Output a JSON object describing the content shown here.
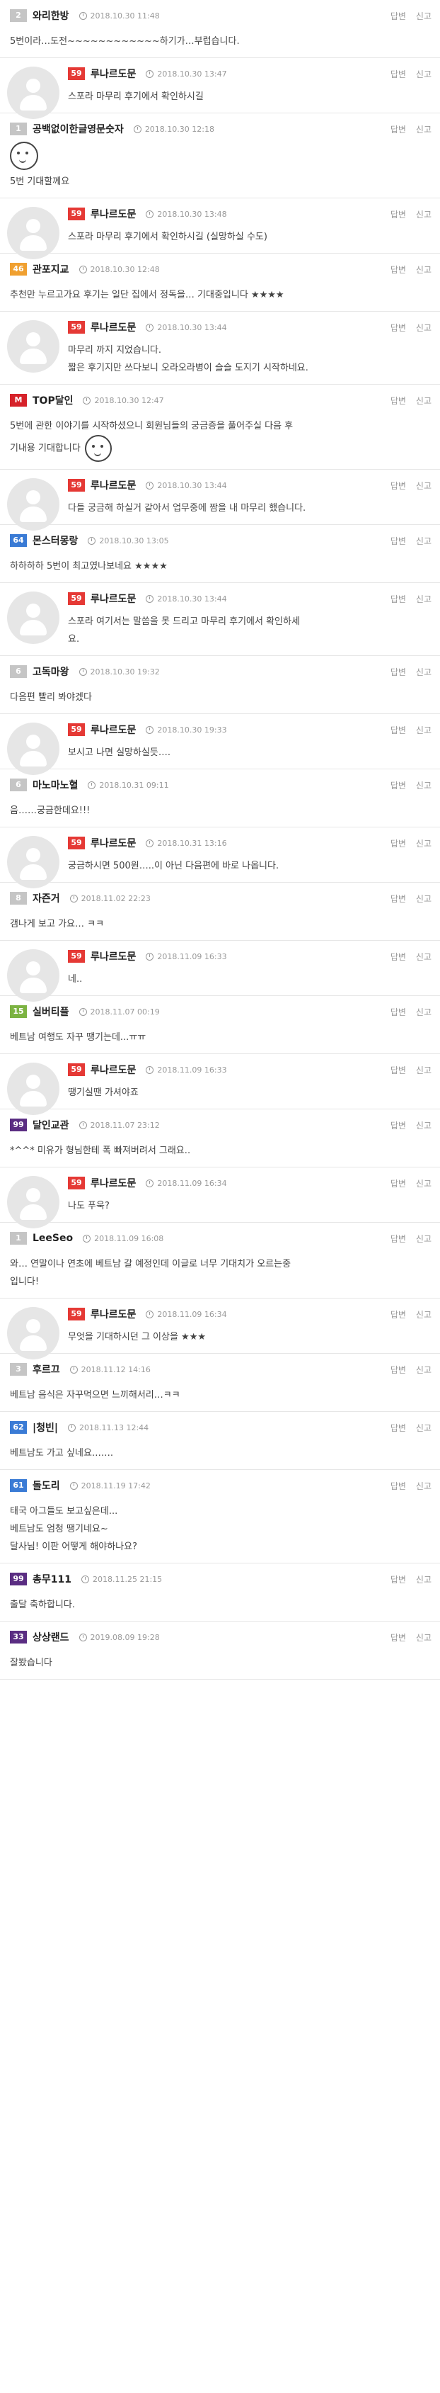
{
  "actions": {
    "reply": "답변",
    "report": "신고"
  },
  "level_colors": {
    "admin": "#e53935",
    "top": "#d6222a",
    "gray": "#c5c5c5",
    "blue": "#3a7bd5",
    "orange": "#f0a030",
    "green": "#7cb342",
    "purple": "#5a2d82"
  },
  "comments": [
    {
      "type": "top",
      "level": "2",
      "level_color": "gray",
      "nick": "와리한방",
      "time": "2018.10.30 11:48",
      "text": "5번이라…도전~~~~~~~~~~~~하기가…부럽습니다."
    },
    {
      "type": "reply",
      "level": "59",
      "level_color": "admin",
      "nick": "루나르도문",
      "time": "2018.10.30 13:47",
      "text": "스포라 마무리 후기에서 확인하시길"
    },
    {
      "type": "top",
      "level": "1",
      "level_color": "gray",
      "nick": "공백없이한글영문숫자",
      "time": "2018.10.30 12:18",
      "text": "5번 기대할께요",
      "emoticon": "e1"
    },
    {
      "type": "reply",
      "level": "59",
      "level_color": "admin",
      "nick": "루나르도문",
      "time": "2018.10.30 13:48",
      "text": "스포라 마무리 후기에서 확인하시길 (실망하실 수도)"
    },
    {
      "type": "top",
      "level": "46",
      "level_color": "orange",
      "nick": "관포지교",
      "time": "2018.10.30 12:48",
      "text": "추천만 누르고가요 후기는 일단 집에서 정독을… 기대중입니다 ★★★★"
    },
    {
      "type": "reply",
      "level": "59",
      "level_color": "admin",
      "nick": "루나르도문",
      "time": "2018.10.30 13:44",
      "text": "마무리 까지 지었습니다.\n짧은 후기지만 쓰다보니 오라오라병이 슬슬 도지기 시작하네요."
    },
    {
      "type": "top",
      "level": "M",
      "level_color": "top",
      "nick": "TOP달인",
      "time": "2018.10.30 12:47",
      "text": "5번에 관한 이야기를 시작하셨으니 회원님들의 궁금증을 풀어주실 다음 후\n기내용 기대합니다",
      "emoticon": "e2"
    },
    {
      "type": "reply",
      "level": "59",
      "level_color": "admin",
      "nick": "루나르도문",
      "time": "2018.10.30 13:44",
      "text": "다들 궁금해 하실거 같아서 업무중에 짬을 내 마무리 했습니다."
    },
    {
      "type": "top",
      "level": "64",
      "level_color": "blue",
      "nick": "몬스터몽랑",
      "time": "2018.10.30 13:05",
      "text": "하하하하 5번이 최고였나보네요 ★★★★"
    },
    {
      "type": "reply",
      "level": "59",
      "level_color": "admin",
      "nick": "루나르도문",
      "time": "2018.10.30 13:44",
      "text": "스포라 여기서는 말씀을 못 드리고 마무리 후기에서 확인하세\n요."
    },
    {
      "type": "top",
      "level": "6",
      "level_color": "gray",
      "nick": "고독마왕",
      "time": "2018.10.30 19:32",
      "text": "다음편 빨리 봐야겠다"
    },
    {
      "type": "reply",
      "level": "59",
      "level_color": "admin",
      "nick": "루나르도문",
      "time": "2018.10.30 19:33",
      "text": "보시고 나면 실망하실듯…."
    },
    {
      "type": "top",
      "level": "6",
      "level_color": "gray",
      "nick": "마노마노혈",
      "time": "2018.10.31 09:11",
      "text": "음……궁금한데요!!!"
    },
    {
      "type": "reply",
      "level": "59",
      "level_color": "admin",
      "nick": "루나르도문",
      "time": "2018.10.31 13:16",
      "text": "궁금하시면 500원…..이 아닌 다음편에 바로 나옵니다."
    },
    {
      "type": "top",
      "level": "8",
      "level_color": "gray",
      "nick": "자즌거",
      "time": "2018.11.02 22:23",
      "text": "갬나게 보고 가요… ㅋㅋ"
    },
    {
      "type": "reply",
      "level": "59",
      "level_color": "admin",
      "nick": "루나르도문",
      "time": "2018.11.09 16:33",
      "text": "네.."
    },
    {
      "type": "top",
      "level": "15",
      "level_color": "green",
      "nick": "실버티플",
      "time": "2018.11.07 00:19",
      "text": "베트남 여행도 자꾸 땡기는데...ㅠㅠ"
    },
    {
      "type": "reply",
      "level": "59",
      "level_color": "admin",
      "nick": "루나르도문",
      "time": "2018.11.09 16:33",
      "text": "땡기실땐 가셔야죠"
    },
    {
      "type": "top",
      "level": "99",
      "level_color": "purple",
      "nick": "달인교관",
      "time": "2018.11.07 23:12",
      "text": "*^^* 미유가 형님한테 폭 빠져버려서 그래요.."
    },
    {
      "type": "reply",
      "level": "59",
      "level_color": "admin",
      "nick": "루나르도문",
      "time": "2018.11.09 16:34",
      "text": "나도 푸욱?"
    },
    {
      "type": "top",
      "level": "1",
      "level_color": "gray",
      "nick": "LeeSeo",
      "time": "2018.11.09 16:08",
      "text": "와… 연말이나 연초에 베트남 갈 예정인데 이글로 너무 기대치가 오르는중\n입니다!"
    },
    {
      "type": "reply",
      "level": "59",
      "level_color": "admin",
      "nick": "루나르도문",
      "time": "2018.11.09 16:34",
      "text": "무엇을 기대하시던 그 이상을 ★★★"
    },
    {
      "type": "top",
      "level": "3",
      "level_color": "gray",
      "nick": "후르끄",
      "time": "2018.11.12 14:16",
      "text": "베트남 음식은 자꾸먹으면 느끼해서리…ㅋㅋ"
    },
    {
      "type": "top",
      "level": "62",
      "level_color": "blue",
      "nick": "|청빈|",
      "time": "2018.11.13 12:44",
      "text": "베트남도 가고 싶네요……."
    },
    {
      "type": "top",
      "level": "61",
      "level_color": "blue",
      "nick": "돌도리",
      "time": "2018.11.19 17:42",
      "text": "태국 아그들도 보고싶은데...\n베트남도 엄청 땡기네요~\n달사님! 이판 어떻게 해야하나요?"
    },
    {
      "type": "top",
      "level": "99",
      "level_color": "purple",
      "nick": "총무111",
      "time": "2018.11.25 21:15",
      "text": "출달 축하합니다."
    },
    {
      "type": "top",
      "level": "33",
      "level_color": "purple",
      "nick": "상상랜드",
      "time": "2019.08.09 19:28",
      "text": "잘봤습니다"
    }
  ]
}
